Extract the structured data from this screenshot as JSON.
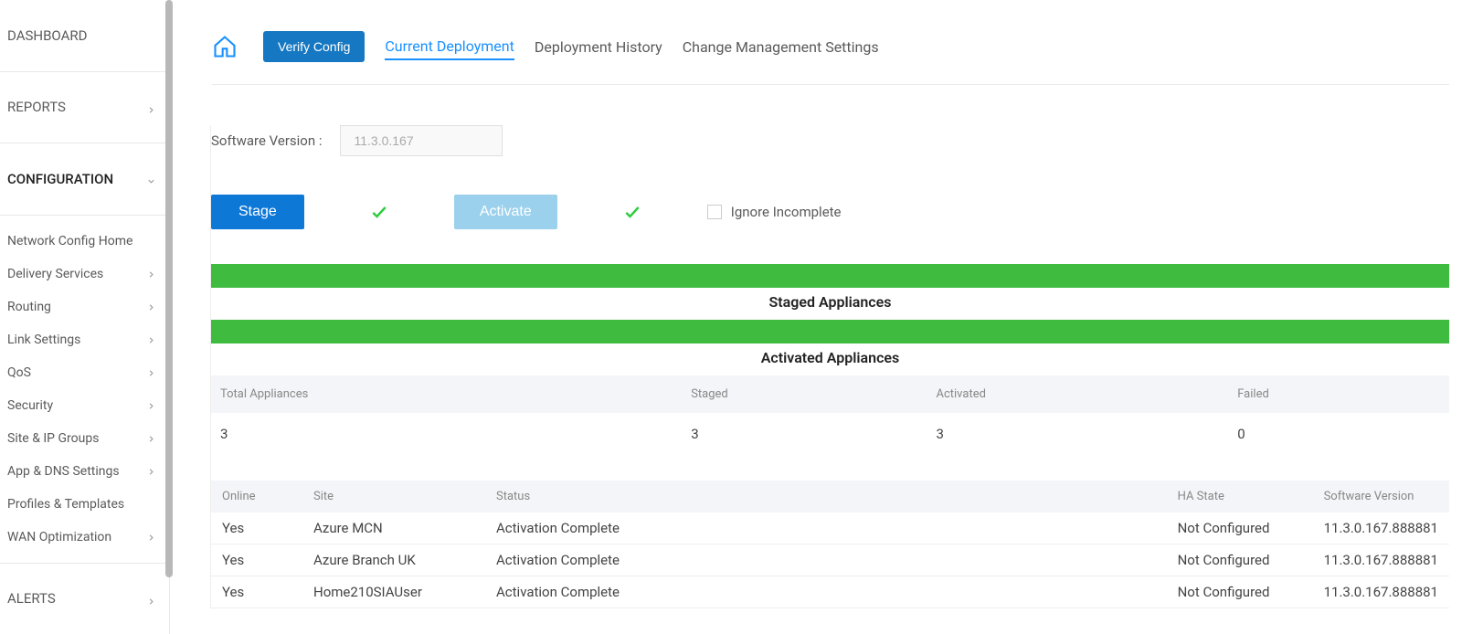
{
  "sidebar": {
    "main": [
      {
        "label": "DASHBOARD",
        "expandable": false
      },
      {
        "label": "REPORTS",
        "expandable": true,
        "icon": "right"
      },
      {
        "label": "CONFIGURATION",
        "expandable": true,
        "icon": "down",
        "active": true
      }
    ],
    "sub": [
      {
        "label": "Network Config Home",
        "expandable": false
      },
      {
        "label": "Delivery Services",
        "expandable": true
      },
      {
        "label": "Routing",
        "expandable": true
      },
      {
        "label": "Link Settings",
        "expandable": true
      },
      {
        "label": "QoS",
        "expandable": true
      },
      {
        "label": "Security",
        "expandable": true
      },
      {
        "label": "Site & IP Groups",
        "expandable": true
      },
      {
        "label": "App & DNS Settings",
        "expandable": true
      },
      {
        "label": "Profiles & Templates",
        "expandable": false
      },
      {
        "label": "WAN Optimization",
        "expandable": true
      }
    ],
    "bottom": [
      {
        "label": "ALERTS",
        "expandable": true
      }
    ]
  },
  "tabs": {
    "verify_label": "Verify Config",
    "items": [
      {
        "label": "Current Deployment",
        "active": true
      },
      {
        "label": "Deployment History",
        "active": false
      },
      {
        "label": "Change Management Settings",
        "active": false
      }
    ]
  },
  "software": {
    "label": "Software Version :",
    "value": "11.3.0.167"
  },
  "actions": {
    "stage_label": "Stage",
    "activate_label": "Activate",
    "ignore_label": "Ignore Incomplete"
  },
  "sections": {
    "staged_title": "Staged Appliances",
    "activated_title": "Activated Appliances"
  },
  "summary": {
    "headers": [
      "Total Appliances",
      "Staged",
      "Activated",
      "Failed"
    ],
    "values": [
      "3",
      "3",
      "3",
      "0"
    ]
  },
  "details": {
    "headers": [
      "Online",
      "Site",
      "Status",
      "HA State",
      "Software Version"
    ],
    "rows": [
      {
        "online": "Yes",
        "site": "Azure MCN",
        "status": "Activation Complete",
        "ha": "Not Configured",
        "ver": "11.3.0.167.888881"
      },
      {
        "online": "Yes",
        "site": "Azure Branch UK",
        "status": "Activation Complete",
        "ha": "Not Configured",
        "ver": "11.3.0.167.888881"
      },
      {
        "online": "Yes",
        "site": "Home210SIAUser",
        "status": "Activation Complete",
        "ha": "Not Configured",
        "ver": "11.3.0.167.888881"
      }
    ]
  }
}
